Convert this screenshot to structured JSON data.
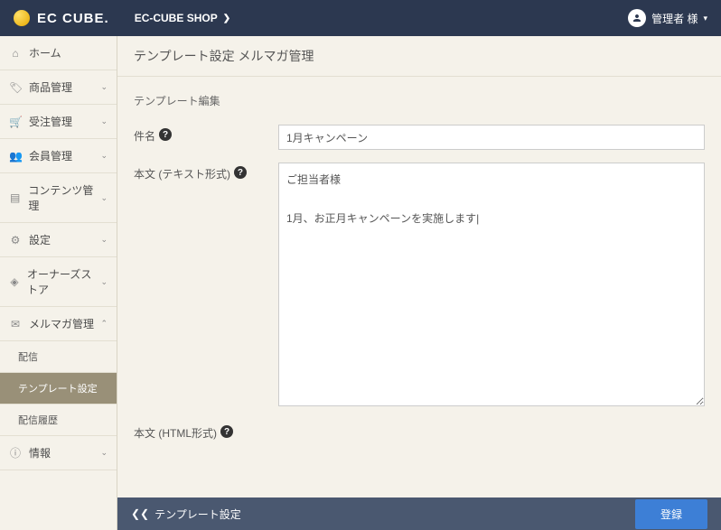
{
  "header": {
    "logo_text": "EC CUBE.",
    "shop_name": "EC-CUBE SHOP",
    "user_label": "管理者 様"
  },
  "sidebar": {
    "items": [
      {
        "icon": "home",
        "label": "ホーム"
      },
      {
        "icon": "tag",
        "label": "商品管理"
      },
      {
        "icon": "cart",
        "label": "受注管理"
      },
      {
        "icon": "users",
        "label": "会員管理"
      },
      {
        "icon": "file",
        "label": "コンテンツ管理"
      },
      {
        "icon": "gear",
        "label": "設定"
      },
      {
        "icon": "store",
        "label": "オーナーズストア"
      },
      {
        "icon": "mail",
        "label": "メルマガ管理"
      },
      {
        "icon": "info",
        "label": "情報"
      }
    ],
    "sub": [
      {
        "label": "配信"
      },
      {
        "label": "テンプレート設定"
      },
      {
        "label": "配信履歴"
      }
    ]
  },
  "breadcrumb": "テンプレート設定 メルマガ管理",
  "form": {
    "section_title": "テンプレート編集",
    "subject_label": "件名",
    "subject_value": "1月キャンペーン",
    "body_text_label": "本文 (テキスト形式)",
    "body_text_value": "ご担当者様\n\n1月、お正月キャンペーンを実施します|",
    "body_html_label": "本文 (HTML形式)"
  },
  "footer": {
    "back_label": "テンプレート設定",
    "submit_label": "登録"
  }
}
